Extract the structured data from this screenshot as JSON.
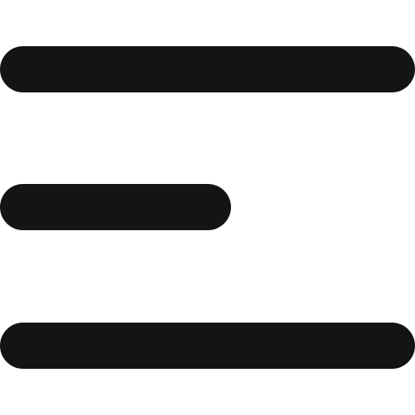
{
  "icon": {
    "name": "menu-icon",
    "color": "#141414",
    "background": "#ffffff"
  }
}
